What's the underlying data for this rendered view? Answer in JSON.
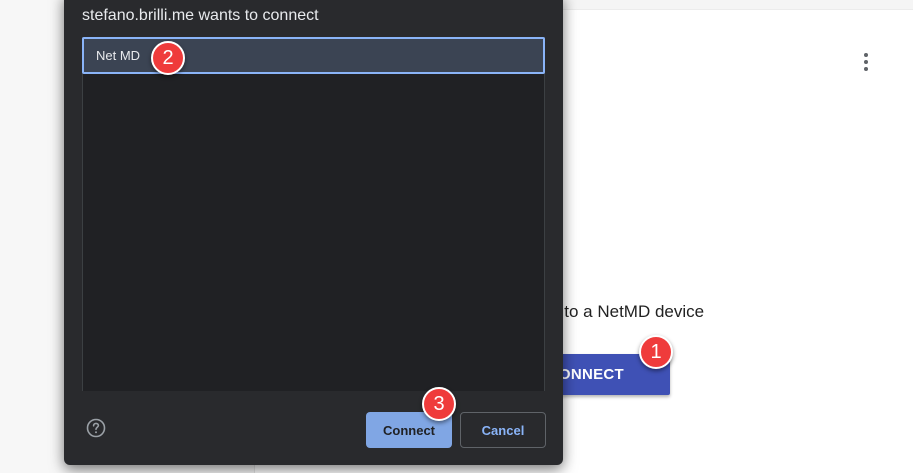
{
  "background_page": {
    "instruction_text": "connect to a NetMD device",
    "connect_button_label": "CONNECT",
    "menu_icon": "more-vert-icon"
  },
  "chooser_dialog": {
    "title": "stefano.brilli.me wants to connect",
    "devices": [
      {
        "name": "Net MD",
        "selected": true
      }
    ],
    "help_icon": "help-circle-icon",
    "connect_label": "Connect",
    "cancel_label": "Cancel"
  },
  "step_markers": [
    "1",
    "2",
    "3"
  ],
  "colors": {
    "dialog_bg": "#292a2d",
    "list_bg": "#202124",
    "selected_row_bg": "#3b4453",
    "focus_ring": "#8ab4f8",
    "primary_button": "#8ab4f8",
    "page_connect_button": "#3f51b5",
    "marker": "#ef3b3b"
  }
}
